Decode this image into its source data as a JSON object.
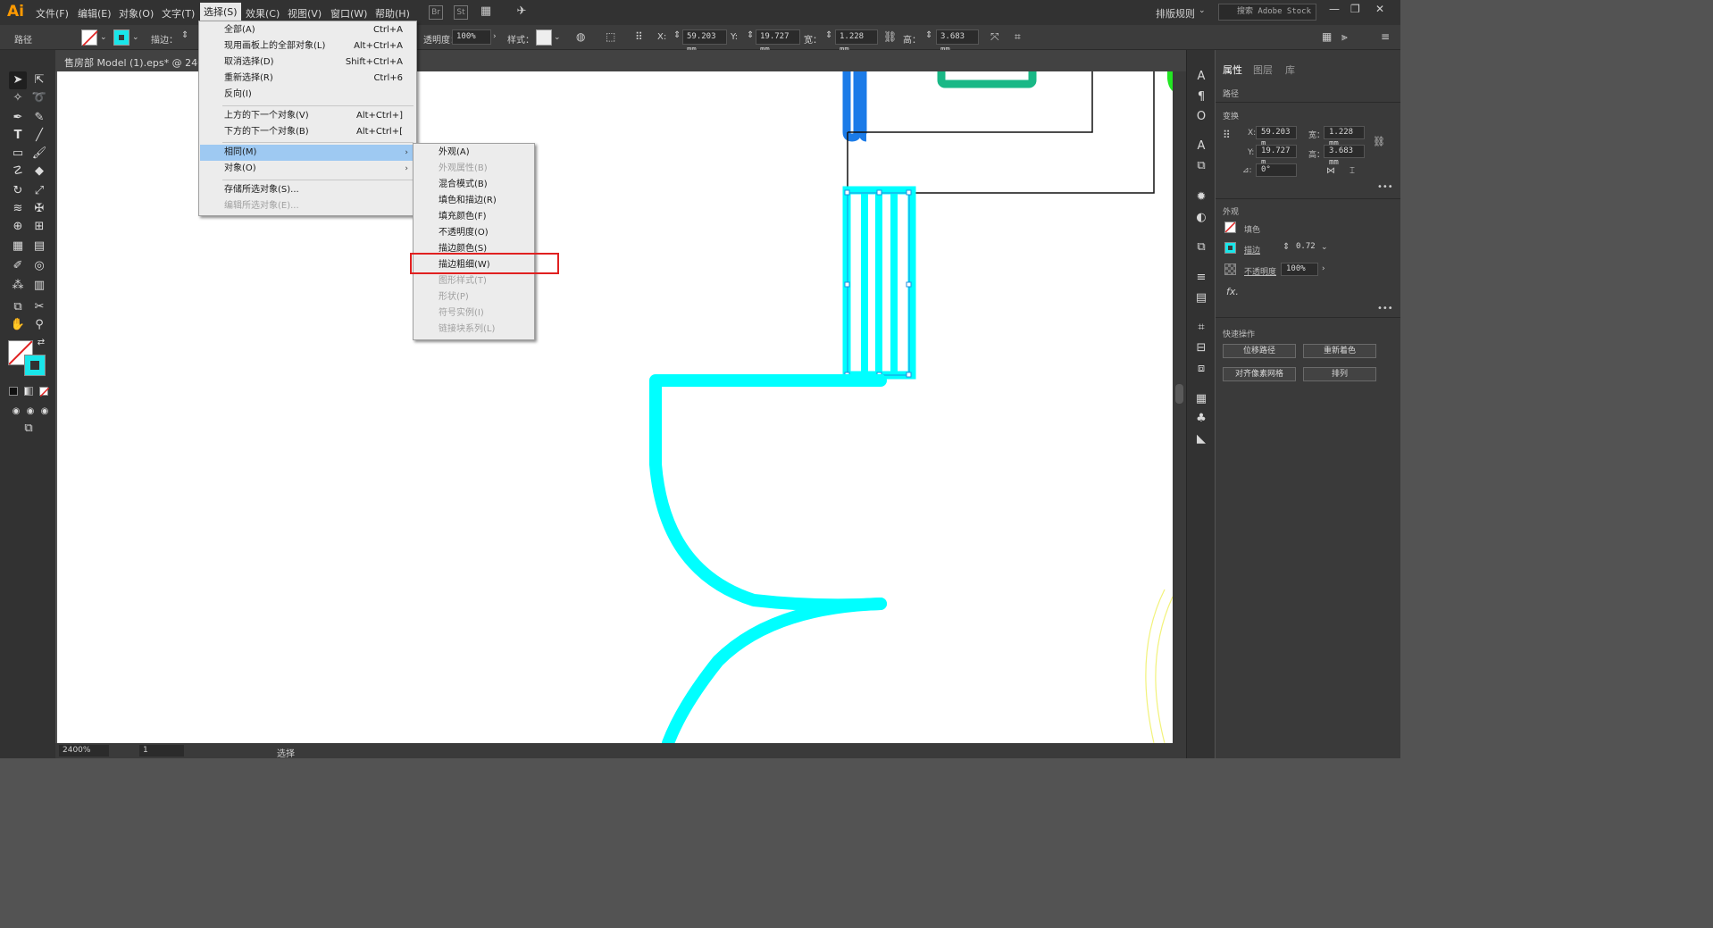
{
  "app": {
    "logo": "Ai",
    "menus": [
      "文件(F)",
      "编辑(E)",
      "对象(O)",
      "文字(T)",
      "选择(S)",
      "效果(C)",
      "视图(V)",
      "窗口(W)",
      "帮助(H)"
    ],
    "bridge_icon": "Br",
    "stock_icon": "St",
    "workspace": "排版规则",
    "search_placeholder": "搜索 Adobe Stock",
    "window_controls": [
      "—",
      "❐",
      "✕"
    ]
  },
  "controlbar": {
    "object_type": "路径",
    "stroke_label": "描边：",
    "opacity_label": "透明度：",
    "opacity_value": "100%",
    "style_label": "样式：",
    "x_label": "X:",
    "x_value": "59.203 mm",
    "y_label": "Y:",
    "y_value": "19.727 mm",
    "w_label": "宽：",
    "w_value": "1.228 mm",
    "h_label": "高：",
    "h_value": "3.683 mm",
    "stroke_color": "#19e6ea"
  },
  "document": {
    "title": "售房部 Model (1).eps* @ 2400%"
  },
  "statusbar": {
    "zoom": "2400%",
    "artboard": "1",
    "status": "选择"
  },
  "select_menu": {
    "items": [
      {
        "label": "全部(A)",
        "shortcut": "Ctrl+A"
      },
      {
        "label": "现用画板上的全部对象(L)",
        "shortcut": "Alt+Ctrl+A"
      },
      {
        "label": "取消选择(D)",
        "shortcut": "Shift+Ctrl+A"
      },
      {
        "label": "重新选择(R)",
        "shortcut": "Ctrl+6"
      },
      {
        "label": "反向(I)",
        "shortcut": ""
      },
      {
        "label": "上方的下一个对象(V)",
        "shortcut": "Alt+Ctrl+]"
      },
      {
        "label": "下方的下一个对象(B)",
        "shortcut": "Alt+Ctrl+["
      },
      {
        "label": "相同(M)",
        "shortcut": ""
      },
      {
        "label": "对象(O)",
        "shortcut": ""
      },
      {
        "label": "存储所选对象(S)...",
        "shortcut": ""
      },
      {
        "label": "编辑所选对象(E)...",
        "shortcut": ""
      }
    ]
  },
  "same_menu": {
    "items": [
      "外观(A)",
      "外观属性(B)",
      "混合模式(B)",
      "填色和描边(R)",
      "填充颜色(F)",
      "不透明度(O)",
      "描边颜色(S)",
      "描边粗细(W)",
      "图形样式(T)",
      "形状(P)",
      "符号实例(I)",
      "链接块系列(L)"
    ]
  },
  "properties": {
    "tabs": [
      "属性",
      "图层",
      "库"
    ],
    "object_type": "路径",
    "transform_title": "变换",
    "x_label": "X:",
    "x_value": "59.203 m",
    "y_label": "Y:",
    "y_value": "19.727 m",
    "w_label": "宽：",
    "w_value": "1.228 mm",
    "h_label": "高：",
    "h_value": "3.683 mm",
    "angle_label": "⊿:",
    "angle_value": "0°",
    "appearance_title": "外观",
    "fill_label": "填色",
    "stroke_label": "描边",
    "stroke_value": "0.72",
    "opacity_label": "不透明度",
    "opacity_value": "100%",
    "fx_label": "fx.",
    "quick_title": "快速操作",
    "quick_buttons": [
      "位移路径",
      "重新着色",
      "对齐像素网格",
      "排列"
    ]
  },
  "colors": {
    "accent_cyan": "#00ffff",
    "selection_blue": "#1b8fe0",
    "highlight_red": "#e02020",
    "menu_highlight": "#9ec9f2"
  }
}
